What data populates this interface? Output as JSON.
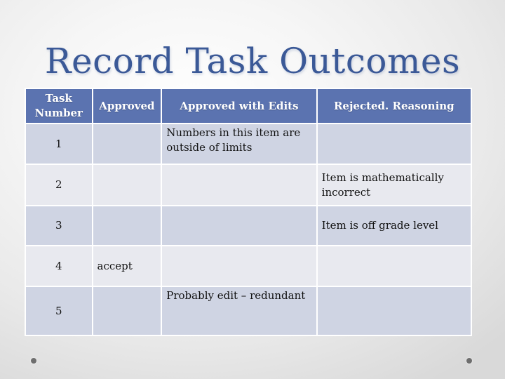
{
  "slide": {
    "title": "Record Task Outcomes"
  },
  "table": {
    "headers": [
      {
        "key": "task_number",
        "label": "Task Number"
      },
      {
        "key": "approved",
        "label": "Approved"
      },
      {
        "key": "approved_with_edits",
        "label": "Approved with Edits"
      },
      {
        "key": "rejected_reasoning",
        "label": "Rejected.  Reasoning"
      }
    ],
    "rows": [
      {
        "task_number": "1",
        "approved": "",
        "approved_with_edits": "Numbers in this item are outside of limits",
        "rejected_reasoning": ""
      },
      {
        "task_number": "2",
        "approved": "",
        "approved_with_edits": "",
        "rejected_reasoning": "Item is mathematically incorrect"
      },
      {
        "task_number": "3",
        "approved": "",
        "approved_with_edits": "",
        "rejected_reasoning": "Item is off grade level"
      },
      {
        "task_number": "4",
        "approved": "accept",
        "approved_with_edits": "",
        "rejected_reasoning": ""
      },
      {
        "task_number": "5",
        "approved": "",
        "approved_with_edits": "Probably edit – redundant",
        "rejected_reasoning": ""
      }
    ]
  },
  "colors": {
    "title": "#3b5997",
    "header_bg": "#5b73b0",
    "row_odd_bg": "#cfd4e3",
    "row_even_bg": "#e8e9ef"
  },
  "decorations": {
    "bottom_dots": [
      "bullet-dot-left",
      "bullet-dot-right"
    ]
  }
}
